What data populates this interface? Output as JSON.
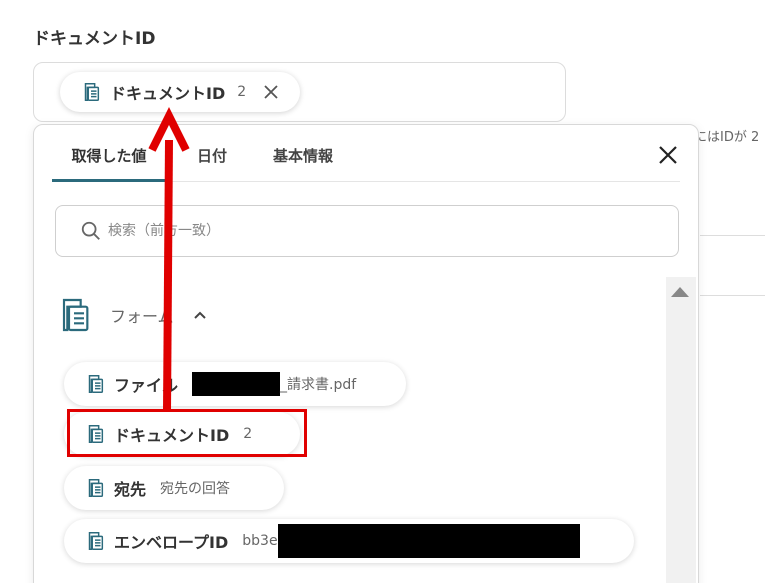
{
  "field": {
    "label": "ドキュメントID",
    "token": {
      "name": "ドキュメントID",
      "value": "2"
    }
  },
  "background_hint": "にはIDが 2",
  "panel": {
    "tabs": [
      {
        "label": "取得した値",
        "active": true
      },
      {
        "label": "日付",
        "active": false
      },
      {
        "label": "基本情報",
        "active": false
      }
    ],
    "search": {
      "placeholder": "検索（前方一致）",
      "value": ""
    },
    "group": {
      "name": "フォーム"
    },
    "items": [
      {
        "name": "ファイル",
        "value_suffix": "_請求書.pdf",
        "redacted": true
      },
      {
        "name": "ドキュメントID",
        "value": "2",
        "highlighted": true
      },
      {
        "name": "宛先",
        "value": "宛先の回答"
      },
      {
        "name": "エンベロープID",
        "value_prefix": "bb3e",
        "redacted": true
      }
    ]
  },
  "colors": {
    "accent": "#2b6a7c",
    "highlight": "#e00000",
    "icon": "#2b6a7c"
  }
}
